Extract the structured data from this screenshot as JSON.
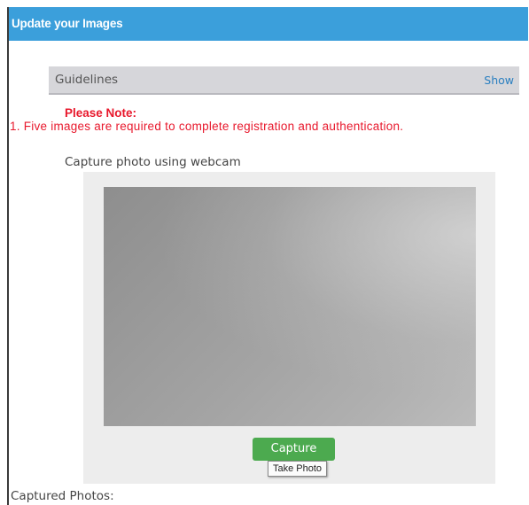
{
  "panel": {
    "title": "Update your Images"
  },
  "guidelines": {
    "title": "Guidelines",
    "toggle_label": "Show"
  },
  "note": {
    "heading": "Please Note:",
    "items": [
      "1. Five images are required to complete registration and authentication."
    ]
  },
  "webcam": {
    "label": "Capture photo using webcam",
    "capture_button_label": "Capture",
    "capture_tooltip": "Take Photo"
  },
  "captured": {
    "label": "Captured Photos:"
  },
  "colors": {
    "header_bg": "#3b9fdb",
    "note_red": "#e8182c",
    "button_green": "#4caa4f",
    "link_blue": "#2a7fc0"
  }
}
